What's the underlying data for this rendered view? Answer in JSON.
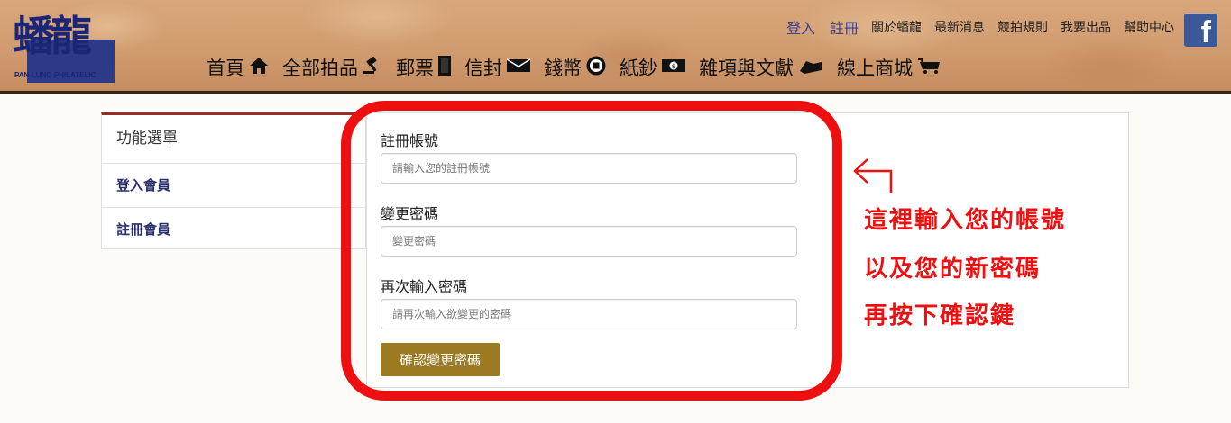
{
  "header": {
    "logo": {
      "text": "蟠龍",
      "subtitle": "PAN-LUNG PHILATELIC"
    },
    "top_links": [
      {
        "label": "登入",
        "name": "login"
      },
      {
        "label": "註冊",
        "name": "register"
      },
      {
        "label": "關於蟠龍",
        "name": "about"
      },
      {
        "label": "最新消息",
        "name": "news"
      },
      {
        "label": "競拍規則",
        "name": "auction-rules"
      },
      {
        "label": "我要出品",
        "name": "consign"
      },
      {
        "label": "幫助中心",
        "name": "help"
      }
    ],
    "facebook": {
      "icon": "facebook-icon",
      "glyph": "f",
      "color": "#3b5998"
    },
    "nav": [
      {
        "label": "首頁",
        "icon": "home-icon"
      },
      {
        "label": "全部拍品",
        "icon": "gavel-icon"
      },
      {
        "label": "郵票",
        "icon": "stamp-icon"
      },
      {
        "label": "信封",
        "icon": "envelope-icon"
      },
      {
        "label": "錢幣",
        "icon": "coin-icon"
      },
      {
        "label": "紙鈔",
        "icon": "banknote-icon"
      },
      {
        "label": "雜項與文獻",
        "icon": "misc-icon"
      },
      {
        "label": "線上商城",
        "icon": "shop-icon"
      }
    ]
  },
  "sidebar": {
    "title": "功能選單",
    "items": [
      {
        "label": "登入會員"
      },
      {
        "label": "註冊會員"
      }
    ]
  },
  "form": {
    "account": {
      "label": "註冊帳號",
      "placeholder": "請輸入您的註冊帳號",
      "value": ""
    },
    "password": {
      "label": "變更密碼",
      "placeholder": "變更密碼",
      "value": ""
    },
    "confirm": {
      "label": "再次輸入密碼",
      "placeholder": "請再次輸入欲變更的密碼",
      "value": ""
    },
    "submit_label": "確認變更密碼"
  },
  "annotation": {
    "color": "#ee1010",
    "lines": [
      "這裡輸入您的帳號",
      "以及您的新密碼",
      "再按下確認鍵"
    ]
  },
  "colors": {
    "header_bg": "#cf9a6e",
    "accent_button": "#9b7a22",
    "link_blue": "#3c3f8a",
    "sidebar_accent": "#9b2a2a"
  }
}
